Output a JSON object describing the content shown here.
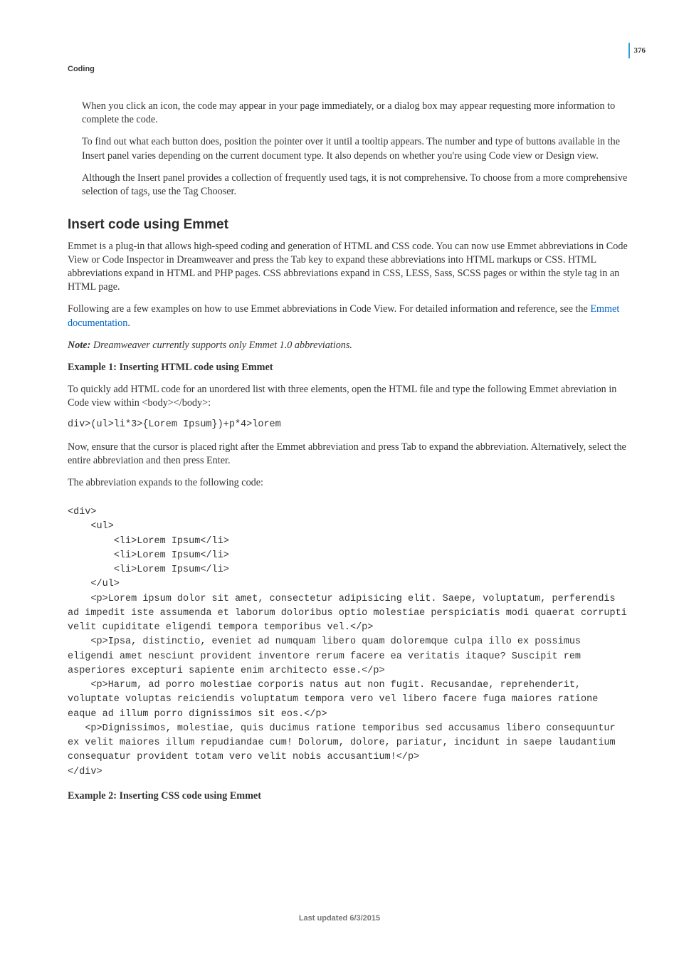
{
  "header": {
    "section": "Coding",
    "page_number": "376"
  },
  "intro": {
    "p1": "When you click an icon, the code may appear in your page immediately, or a dialog box may appear requesting more information to complete the code.",
    "p2": "To find out what each button does, position the pointer over it until a tooltip appears. The number and type of buttons available in the Insert panel varies depending on the current document type. It also depends on whether you're using Code view or Design view.",
    "p3": "Although the Insert panel provides a collection of frequently used tags, it is not comprehensive. To choose from a more comprehensive selection of tags, use the Tag Chooser."
  },
  "emmet": {
    "heading": "Insert code using Emmet",
    "p1": "Emmet is a plug-in that allows high-speed coding and generation of HTML and CSS code. You can now use Emmet abbreviations in Code View or Code Inspector in Dreamweaver and press the Tab key to expand these abbreviations into HTML markups or CSS. HTML abbreviations expand in HTML and PHP pages. CSS abbreviations expand in CSS, LESS, Sass, SCSS pages or within the style tag in an HTML page.",
    "p2_a": "Following are a few examples on how to use Emmet abbreviations in Code View. For detailed information and reference, see the ",
    "p2_link": "Emmet documentation",
    "p2_b": ".",
    "note_label": "Note: ",
    "note_body": "Dreamweaver currently supports only Emmet 1.0 abbreviations.",
    "ex1_title": "Example 1: Inserting HTML code using Emmet",
    "ex1_p1": "To quickly add HTML code for an unordered list with three elements, open the HTML file and type the following Emmet abreviation in Code view within <body></body>:",
    "ex1_code": "div>(ul>li*3>{Lorem Ipsum})+p*4>lorem",
    "ex1_p2": "Now, ensure that the cursor is placed right after the Emmet abbreviation and press Tab to expand the abbreviation. Alternatively, select the entire abbreviation and then press Enter.",
    "ex1_p3": "The abbreviation expands to the following code:",
    "ex1_output": "<div> \n    <ul> \n        <li>Lorem Ipsum</li> \n        <li>Lorem Ipsum</li> \n        <li>Lorem Ipsum</li> \n    </ul> \n    <p>Lorem ipsum dolor sit amet, consectetur adipisicing elit. Saepe, voluptatum, perferendis ad impedit iste assumenda et laborum doloribus optio molestiae perspiciatis modi quaerat corrupti velit cupiditate eligendi tempora temporibus vel.</p> \n    <p>Ipsa, distinctio, eveniet ad numquam libero quam doloremque culpa illo ex possimus eligendi amet nesciunt provident inventore rerum facere ea veritatis itaque? Suscipit rem asperiores excepturi sapiente enim architecto esse.</p> \n    <p>Harum, ad porro molestiae corporis natus aut non fugit. Recusandae, reprehenderit, voluptate voluptas reiciendis voluptatum tempora vero vel libero facere fuga maiores ratione eaque ad illum porro dignissimos sit eos.</p> \n   <p>Dignissimos, molestiae, quis ducimus ratione temporibus sed accusamus libero consequuntur ex velit maiores illum repudiandae cum! Dolorum, dolore, pariatur, incidunt in saepe laudantium consequatur provident totam vero velit nobis accusantium!</p> \n</div>",
    "ex2_title": "Example 2: Inserting CSS code using Emmet"
  },
  "footer": "Last updated 6/3/2015"
}
